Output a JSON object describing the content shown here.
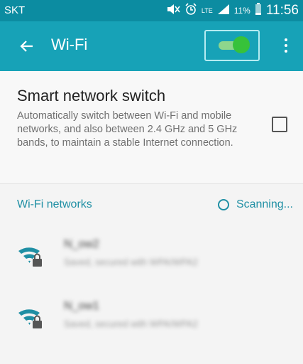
{
  "status_bar": {
    "carrier": "SKT",
    "network_type": "LTE",
    "battery": "11%",
    "time": "11:56"
  },
  "app_bar": {
    "title": "Wi-Fi",
    "toggle_state": "on"
  },
  "smart_switch": {
    "title": "Smart network switch",
    "description": "Automatically switch between Wi-Fi and mobile networks, and also between 2.4 GHz and 5 GHz bands, to maintain a stable Internet connection.",
    "checked": false
  },
  "networks": {
    "header": "Wi-Fi networks",
    "scanning_label": "Scanning...",
    "items": [
      {
        "ssid": "N_ow2",
        "security": "Saved, secured with WPA/WPA2"
      },
      {
        "ssid": "N_ow1",
        "security": "Saved, secured with WPA/WPA2"
      }
    ]
  },
  "colors": {
    "status_bar": "#0c8ca1",
    "app_bar": "#17a2b7",
    "accent": "#1f8fa4",
    "toggle_on": "#37c23a"
  }
}
